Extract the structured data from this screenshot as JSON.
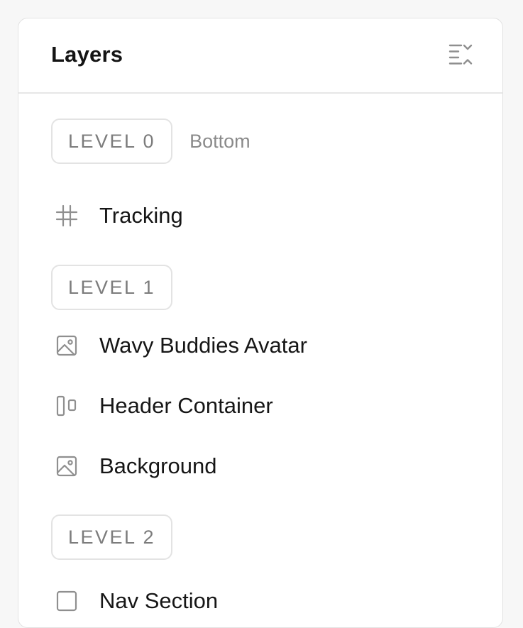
{
  "panel": {
    "title": "Layers",
    "collapse_icon": "collapse-all-icon"
  },
  "levels": [
    {
      "label": "LEVEL 0",
      "sub": "Bottom"
    },
    {
      "label": "LEVEL 1"
    },
    {
      "label": "LEVEL 2"
    }
  ],
  "layers": [
    {
      "label": "Tracking",
      "icon": "grid-icon"
    },
    {
      "label": "Wavy Buddies Avatar",
      "icon": "image-icon"
    },
    {
      "label": "Header Container",
      "icon": "columns-icon"
    },
    {
      "label": "Background",
      "icon": "image-icon"
    },
    {
      "label": "Nav Section",
      "icon": "frame-icon"
    }
  ],
  "colors": {
    "text": "#161616",
    "muted": "#7c7c7c",
    "border": "#e3e3e3",
    "icon": "#8f8f8f"
  }
}
